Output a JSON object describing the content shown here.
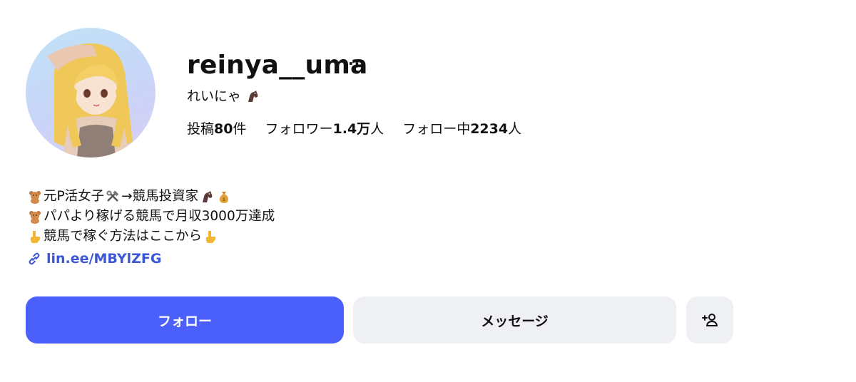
{
  "profile": {
    "username": "reinya__uma",
    "more_label": "···",
    "display_name": "れいにゃ",
    "display_name_icon": "horse-icon"
  },
  "stats": {
    "posts_label": "投稿",
    "posts_value": "80",
    "posts_unit": "件",
    "followers_label": "フォロワー",
    "followers_value": "1.4万",
    "followers_unit": "人",
    "following_label": "フォロー中",
    "following_value": "2234",
    "following_unit": "人"
  },
  "bio": {
    "line1_text_a": "元P活女子",
    "line1_text_b": "→競馬投資家",
    "line1_icons": [
      "teddy-bear-icon",
      "hammer-wrench-icon",
      "horse-icon",
      "money-bag-icon"
    ],
    "line2_text": "パパより稼げる競馬で月収3000万達成",
    "line2_icons": [
      "teddy-bear-icon"
    ],
    "line3_text": "競馬で稼ぐ方法はここから",
    "line3_icons": [
      "pointing-down-icon",
      "pointing-down-icon"
    ]
  },
  "link": {
    "icon": "link-icon",
    "text": "lin.ee/MBYlZFG"
  },
  "buttons": {
    "follow_label": "フォロー",
    "message_label": "メッセージ",
    "add_friend_icon": "add-person-icon"
  },
  "colors": {
    "primary": "#4b5ffb",
    "secondary_bg": "#eff0f3",
    "link": "#3b57d6"
  }
}
